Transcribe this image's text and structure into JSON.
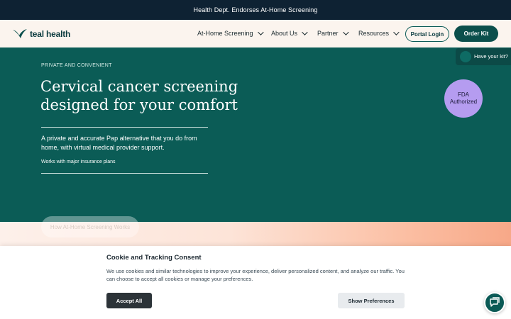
{
  "announcement": {
    "text": "Health Dept. Endorses At-Home Screening"
  },
  "brand": {
    "name": "teal health"
  },
  "nav": {
    "items": [
      {
        "label": "At-Home Screening"
      },
      {
        "label": "About Us"
      },
      {
        "label": "Partner"
      },
      {
        "label": "Resources"
      }
    ],
    "portal_label": "Portal Login",
    "order_label": "Order Kit"
  },
  "kit_tab": {
    "label": "Have your kit?"
  },
  "hero": {
    "eyebrow": "PRIVATE AND CONVENIENT",
    "headline_line1": "Cervical cancer screening",
    "headline_line2": "designed for your comfort",
    "subtext": "A private and accurate Pap alternative that you do from home, with virtual medical provider support.",
    "insurance": "Works with major insurance plans",
    "badge_line1": "FDA",
    "badge_line2": "Authorized",
    "how_label": "How At-Home Screening Works"
  },
  "cookie": {
    "title": "Cookie and Tracking Consent",
    "text": "We use cookies and similar technologies to improve your experience, deliver personalized content, and analyze our traffic. You can choose to accept all cookies or manage your preferences.",
    "accept_label": "Accept All",
    "prefs_label": "Show Preferences"
  },
  "colors": {
    "announce_bg": "#0e2233",
    "nav_bg": "#fbf4ee",
    "hero_bg": "#0b5c56",
    "badge_bg": "#b59cf0",
    "accent": "#0b4f4c"
  },
  "icons": {
    "logo": "teal-bird-logo-icon",
    "chat": "chat-bubble-icon",
    "chevron": "chevron-down-icon"
  }
}
